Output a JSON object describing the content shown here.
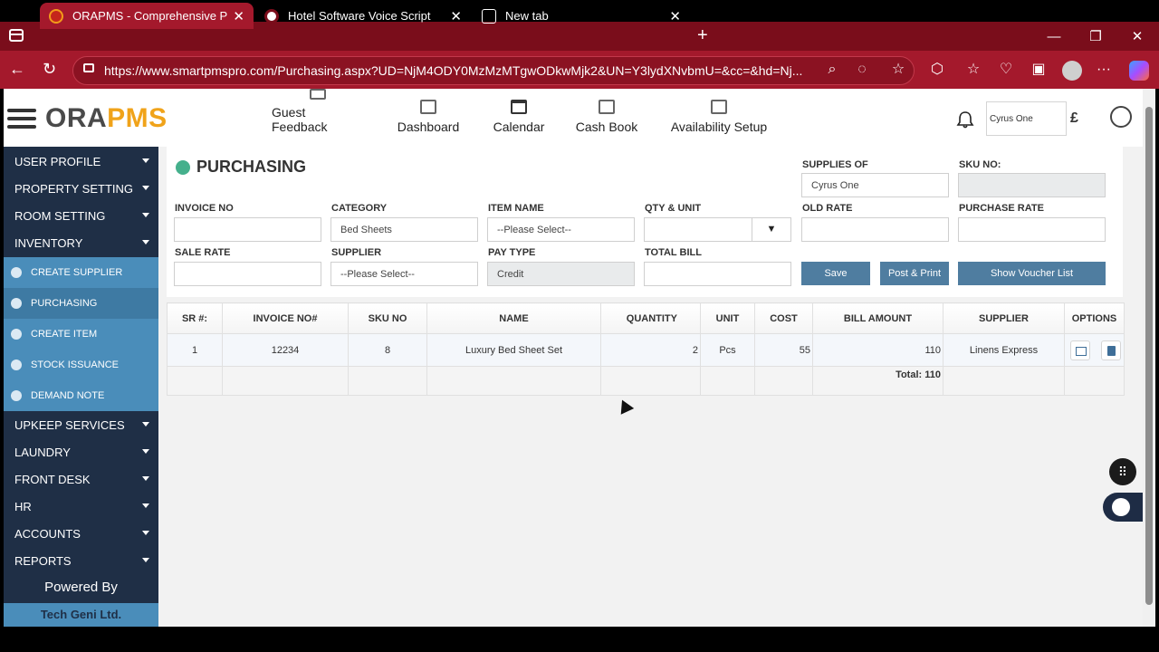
{
  "browser": {
    "tabs": [
      {
        "title": "ORAPMS - Comprehensive Proper",
        "close": "✕"
      },
      {
        "title": "Hotel Software Voice Script",
        "close": "✕"
      },
      {
        "title": "New tab",
        "close": "✕"
      }
    ],
    "new_tab": "+",
    "url": "https://www.smartpmspro.com/Purchasing.aspx?UD=NjM4ODY0MzMzMTgwODkwMjk2&UN=Y3lydXNvbmU=&cc=&hd=Nj...",
    "win_min": "—",
    "win_max": "❐",
    "win_close": "✕",
    "back": "←",
    "reload": "↻",
    "more": "···"
  },
  "header": {
    "logo_ora": "ORA",
    "logo_pms": "PMS",
    "nav": [
      {
        "label": "Guest Feedback"
      },
      {
        "label": "Dashboard"
      },
      {
        "label": "Calendar"
      },
      {
        "label": "Cash Book"
      },
      {
        "label": "Availability Setup"
      }
    ],
    "property": "Cyrus One",
    "currency": "£"
  },
  "sidebar": {
    "items": [
      {
        "label": "USER PROFILE"
      },
      {
        "label": "PROPERTY SETTING"
      },
      {
        "label": "ROOM SETTING"
      },
      {
        "label": "INVENTORY"
      }
    ],
    "sub_items": [
      {
        "label": "CREATE SUPPLIER"
      },
      {
        "label": "PURCHASING"
      },
      {
        "label": "CREATE ITEM"
      },
      {
        "label": "STOCK ISSUANCE"
      },
      {
        "label": "DEMAND NOTE"
      }
    ],
    "items2": [
      {
        "label": "UPKEEP SERVICES"
      },
      {
        "label": "LAUNDRY"
      },
      {
        "label": "FRONT DESK"
      },
      {
        "label": "HR"
      },
      {
        "label": "ACCOUNTS"
      },
      {
        "label": "REPORTS"
      }
    ],
    "powered_by": "Powered By",
    "company": "Tech Geni Ltd."
  },
  "form": {
    "title": "PURCHASING",
    "supplies_of_label": "SUPPLIES OF",
    "supplies_of_value": "Cyrus One",
    "sku_label": "SKU NO:",
    "sku_value": "",
    "invoice_label": "INVOICE NO",
    "invoice_value": "",
    "category_label": "CATEGORY",
    "category_value": "Bed Sheets",
    "item_label": "ITEM NAME",
    "item_value": "--Please Select--",
    "qty_label": "QTY & UNIT",
    "qty_value": "",
    "unit_dropdown": "▼",
    "old_rate_label": "OLD RATE",
    "old_rate_value": "",
    "purchase_rate_label": "PURCHASE RATE",
    "purchase_rate_value": "",
    "sale_rate_label": "SALE RATE",
    "sale_rate_value": "",
    "supplier_label": "SUPPLIER",
    "supplier_value": "--Please Select--",
    "paytype_label": "PAY TYPE",
    "paytype_value": "Credit",
    "total_label": "TOTAL BILL",
    "total_value": "",
    "save": "Save",
    "post_print": "Post & Print",
    "voucher": "Show Voucher List"
  },
  "table": {
    "headers": [
      "SR #:",
      "INVOICE NO#",
      "SKU NO",
      "NAME",
      "QUANTITY",
      "UNIT",
      "COST",
      "BILL AMOUNT",
      "SUPPLIER",
      "OPTIONS"
    ],
    "rows": [
      {
        "sr": "1",
        "invoice": "12234",
        "sku": "8",
        "name": "Luxury Bed Sheet Set",
        "qty": "2",
        "unit": "Pcs",
        "cost": "55",
        "bill": "110",
        "supplier": "Linens Express"
      }
    ],
    "total": "Total: 110"
  },
  "colors": {
    "browser_tab": "#7a0d1b",
    "browser_bar": "#a4192c",
    "sidebar": "#1f2f46",
    "sub_item": "#4a8dba",
    "button": "#4f7da0",
    "logo_accent": "#f0a31a"
  }
}
